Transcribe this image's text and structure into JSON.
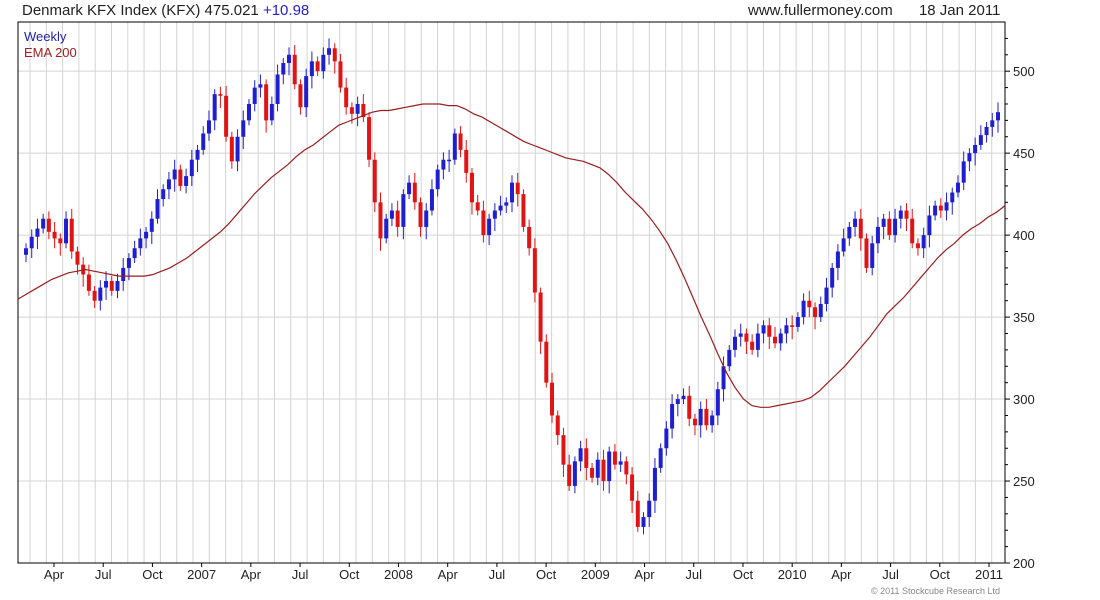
{
  "header": {
    "title": "Denmark KFX Index (KFX) 475.021",
    "change": "+10.98",
    "site": "www.fullermoney.com",
    "date": "18 Jan 2011"
  },
  "legend": {
    "weekly": "Weekly",
    "ema": "EMA 200"
  },
  "copyright": "© 2011 Stockcube Research Ltd",
  "colors": {
    "up": "#1f1fd0",
    "down": "#e01414",
    "ema": "#9b1d1d",
    "grid": "#d4d4d4",
    "axis": "#000000"
  },
  "chart_data": {
    "type": "candlestick",
    "title": "Denmark KFX Index (KFX) 475.021 +10.98",
    "frequency": "weekly",
    "ylim": [
      200,
      530
    ],
    "y_ticks": [
      200,
      250,
      300,
      350,
      400,
      450,
      500
    ],
    "x_tick_labels": [
      "Apr",
      "Jul",
      "Oct",
      "2007",
      "Apr",
      "Jul",
      "Oct",
      "2008",
      "Apr",
      "Jul",
      "Oct",
      "2009",
      "Apr",
      "Jul",
      "Oct",
      "2010",
      "Apr",
      "Jul",
      "Oct",
      "2011"
    ],
    "grid": true,
    "close_series": [
      392,
      399,
      404,
      410,
      402,
      398,
      395,
      410,
      390,
      382,
      376,
      366,
      360,
      368,
      372,
      366,
      372,
      380,
      386,
      392,
      398,
      402,
      410,
      422,
      428,
      434,
      440,
      430,
      436,
      446,
      452,
      462,
      470,
      486,
      485,
      460,
      445,
      460,
      470,
      480,
      490,
      492,
      470,
      480,
      498,
      505,
      510,
      492,
      478,
      497,
      506,
      500,
      510,
      514,
      506,
      490,
      478,
      474,
      480,
      472,
      446,
      420,
      398,
      410,
      415,
      405,
      425,
      432,
      420,
      405,
      415,
      428,
      440,
      446,
      446,
      462,
      452,
      438,
      420,
      415,
      400,
      410,
      415,
      418,
      420,
      432,
      425,
      405,
      392,
      365,
      335,
      310,
      290,
      278,
      260,
      247,
      262,
      270,
      258,
      252,
      263,
      250,
      268,
      260,
      262,
      254,
      238,
      222,
      228,
      238,
      258,
      270,
      282,
      297,
      300,
      302,
      288,
      284,
      294,
      284,
      290,
      306,
      320,
      330,
      338,
      340,
      335,
      330,
      340,
      345,
      338,
      334,
      340,
      345,
      344,
      350,
      360,
      356,
      350,
      358,
      368,
      380,
      390,
      398,
      405,
      410,
      398,
      380,
      395,
      405,
      410,
      400,
      410,
      415,
      410,
      395,
      392,
      400,
      412,
      418,
      415,
      420,
      426,
      432,
      445,
      450,
      455,
      461,
      466,
      470,
      475
    ],
    "ema_200_series": [
      361,
      364,
      367,
      370,
      373,
      375,
      377,
      378,
      379,
      378,
      377,
      376,
      375,
      375,
      375,
      375,
      376,
      378,
      380,
      383,
      386,
      390,
      394,
      398,
      402,
      407,
      413,
      419,
      425,
      430,
      435,
      439,
      443,
      448,
      452,
      455,
      459,
      463,
      467,
      469,
      471,
      473,
      475,
      476,
      476,
      477,
      478,
      479,
      480,
      480,
      480,
      479,
      479,
      477,
      474,
      472,
      469,
      466,
      463,
      460,
      457,
      455,
      453,
      451,
      449,
      447,
      446,
      445,
      443,
      441,
      437,
      432,
      426,
      421,
      416,
      410,
      403,
      395,
      385,
      374,
      362,
      350,
      339,
      327,
      316,
      307,
      300,
      296,
      295,
      295,
      296,
      297,
      298,
      299,
      301,
      305,
      310,
      315,
      320,
      326,
      332,
      338,
      345,
      352,
      357,
      362,
      368,
      374,
      380,
      386,
      391,
      395,
      400,
      404,
      407,
      411,
      414,
      418
    ]
  }
}
